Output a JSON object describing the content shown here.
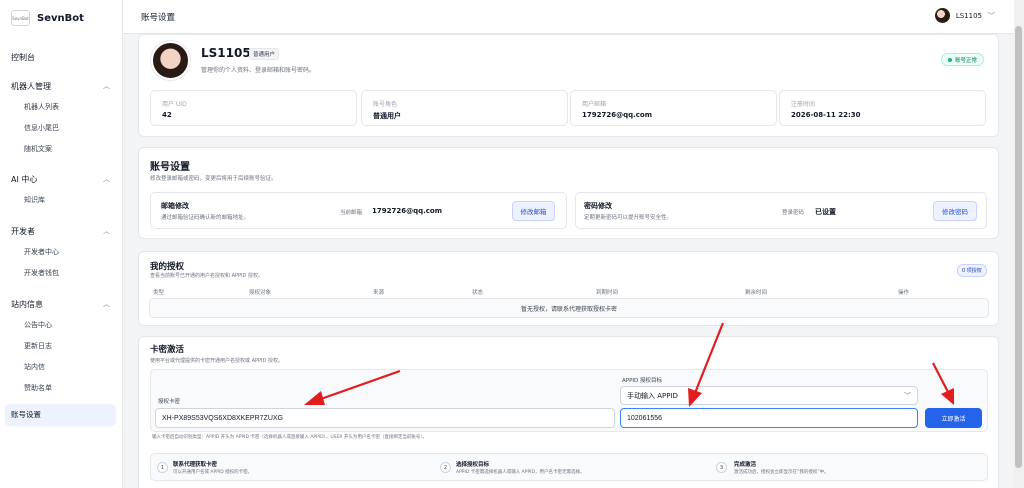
{
  "brand": {
    "logo_text": "SevnBot",
    "name": "SevnBot"
  },
  "sidebar": {
    "dashboard": "控制台",
    "groups": [
      {
        "label": "机器人管理",
        "items": [
          "机器人列表",
          "信息小尾巴",
          "随机文案"
        ]
      },
      {
        "label": "AI 中心",
        "items": [
          "知识库"
        ]
      },
      {
        "label": "开发者",
        "items": [
          "开发者中心",
          "开发者钱包"
        ]
      },
      {
        "label": "站内信息",
        "items": [
          "公告中心",
          "更新日志",
          "站内信",
          "赞助名单"
        ]
      }
    ],
    "active": "账号设置"
  },
  "header": {
    "title": "账号设置",
    "username": "LS1105"
  },
  "profile": {
    "name": "LS1105",
    "role_badge": "普通用户",
    "subtitle": "管理你的个人资料、登录邮箱和账号密码。",
    "status": "账号正常",
    "stats": [
      {
        "label": "用户 UID",
        "value": "42"
      },
      {
        "label": "账号角色",
        "value": "普通用户"
      },
      {
        "label": "用户邮箱",
        "value": "1792726@qq.com"
      },
      {
        "label": "注册时间",
        "value": "2026-08-11 22:30"
      }
    ]
  },
  "account": {
    "title": "账号设置",
    "subtitle": "修改登录邮箱或密码，变更后将用于后续账号验证。",
    "email": {
      "title": "邮箱修改",
      "desc": "通过邮箱验证码确认新的邮箱地址。",
      "current_label": "当前邮箱",
      "current_value": "1792726@qq.com",
      "button": "修改邮箱"
    },
    "password": {
      "title": "密码修改",
      "desc": "定期更新密码可以提升账号安全性。",
      "current_label": "登录密码",
      "current_value": "已设置",
      "button": "修改密码"
    }
  },
  "auth": {
    "title": "我的授权",
    "subtitle": "查看当前账号已开通的用户名授权和 APPID 授权。",
    "count_badge": "0 项授权",
    "columns": [
      "类型",
      "授权对象",
      "来源",
      "状态",
      "到期时间",
      "剩余时间",
      "操作"
    ],
    "empty": "暂无授权，请联系代理获取授权卡密"
  },
  "activate": {
    "title": "卡密激活",
    "subtitle": "使用平台或代理提供的卡密开通用户名授权或 APPID 授权。",
    "card_label": "授权卡密",
    "card_value": "XH-PX89S53VQS6XD8XKEPR7ZUXG",
    "target_label": "APPID 授权目标",
    "target_select": "手动输入 APPID",
    "appid_value": "102061556",
    "submit": "立即激活",
    "hint": "输入卡密后自动识别类型：APPID 开头为 APPID 卡密（选择机器人或直接输入 APPID），USER 开头为用户名卡密（直接绑定当前账号）。",
    "steps": [
      {
        "num": "1",
        "title": "联系代理获取卡密",
        "desc": "可以开通用户名或 APPID 授权的卡密。"
      },
      {
        "num": "2",
        "title": "选择授权目标",
        "desc": "APPID 卡密需选择机器人或输入 APPID，用户名卡密无需选择。"
      },
      {
        "num": "3",
        "title": "完成激活",
        "desc": "激活成功后，授权会立即显示在“我的授权”中。"
      }
    ]
  }
}
